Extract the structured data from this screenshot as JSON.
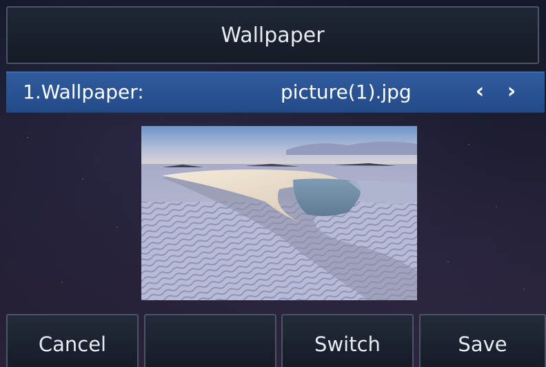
{
  "header": {
    "title": "Wallpaper"
  },
  "setting": {
    "label": "1.Wallpaper:",
    "value": "picture(1).jpg",
    "prev_icon": "chevron-left-icon",
    "next_icon": "chevron-right-icon",
    "prev_glyph": "‹",
    "next_glyph": "›"
  },
  "softkeys": [
    {
      "label": "Cancel"
    },
    {
      "label": ""
    },
    {
      "label": "Switch"
    },
    {
      "label": "Save"
    }
  ],
  "colors": {
    "highlight": "#2f5c9e",
    "text": "#ffffff",
    "button_border": "#4a5566"
  }
}
